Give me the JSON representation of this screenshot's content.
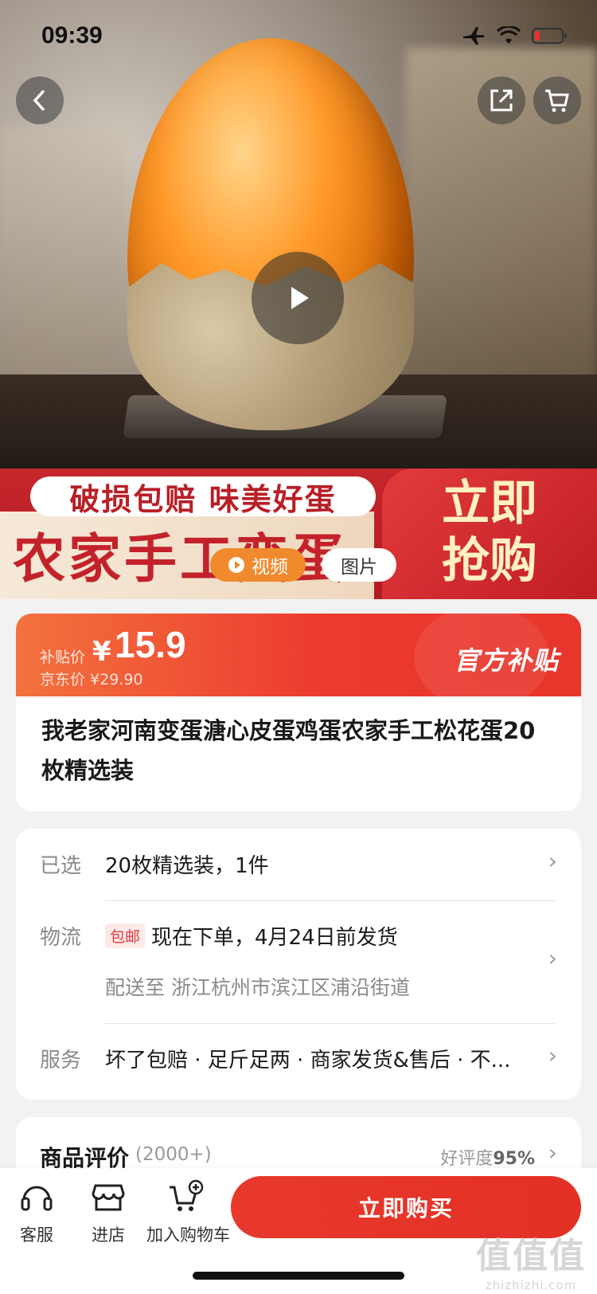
{
  "status_bar": {
    "time": "09:39"
  },
  "media": {
    "slogan": "破损包赔 味美好蛋",
    "big_title": "农家手工变蛋",
    "buy_now_banner": "立即抢购",
    "tabs": [
      {
        "label": "视频",
        "active": true
      },
      {
        "label": "图片",
        "active": false
      }
    ]
  },
  "price": {
    "label": "补贴价",
    "currency": "¥",
    "value": "15.9",
    "original": "京东价 ¥29.90",
    "tag": "官方补贴"
  },
  "product": {
    "title": "我老家河南变蛋溏心皮蛋鸡蛋农家手工松花蛋20枚精选装"
  },
  "specs": {
    "selected": {
      "label": "已选",
      "value": "20枚精选装，1件"
    },
    "logistics": {
      "label": "物流",
      "badge": "包邮",
      "value": "现在下单，4月24日前发货",
      "address": "配送至 浙江杭州市滨江区浦沿街道"
    },
    "service": {
      "label": "服务",
      "value": "坏了包赔 · 足斤足两 · 商家发货&售后 · 不..."
    }
  },
  "reviews": {
    "title": "商品评价",
    "count": "(2000+)",
    "rating_prefix": "好评度",
    "rating": "95%"
  },
  "bottom_bar": {
    "service_label": "客服",
    "store_label": "进店",
    "cart_label": "加入购物车",
    "buy_label": "立即购买"
  },
  "watermark": {
    "big": "值值值",
    "small": "zhizhizhi.com"
  },
  "colors": {
    "accent": "#e8392c",
    "orange": "#f08a2c"
  }
}
